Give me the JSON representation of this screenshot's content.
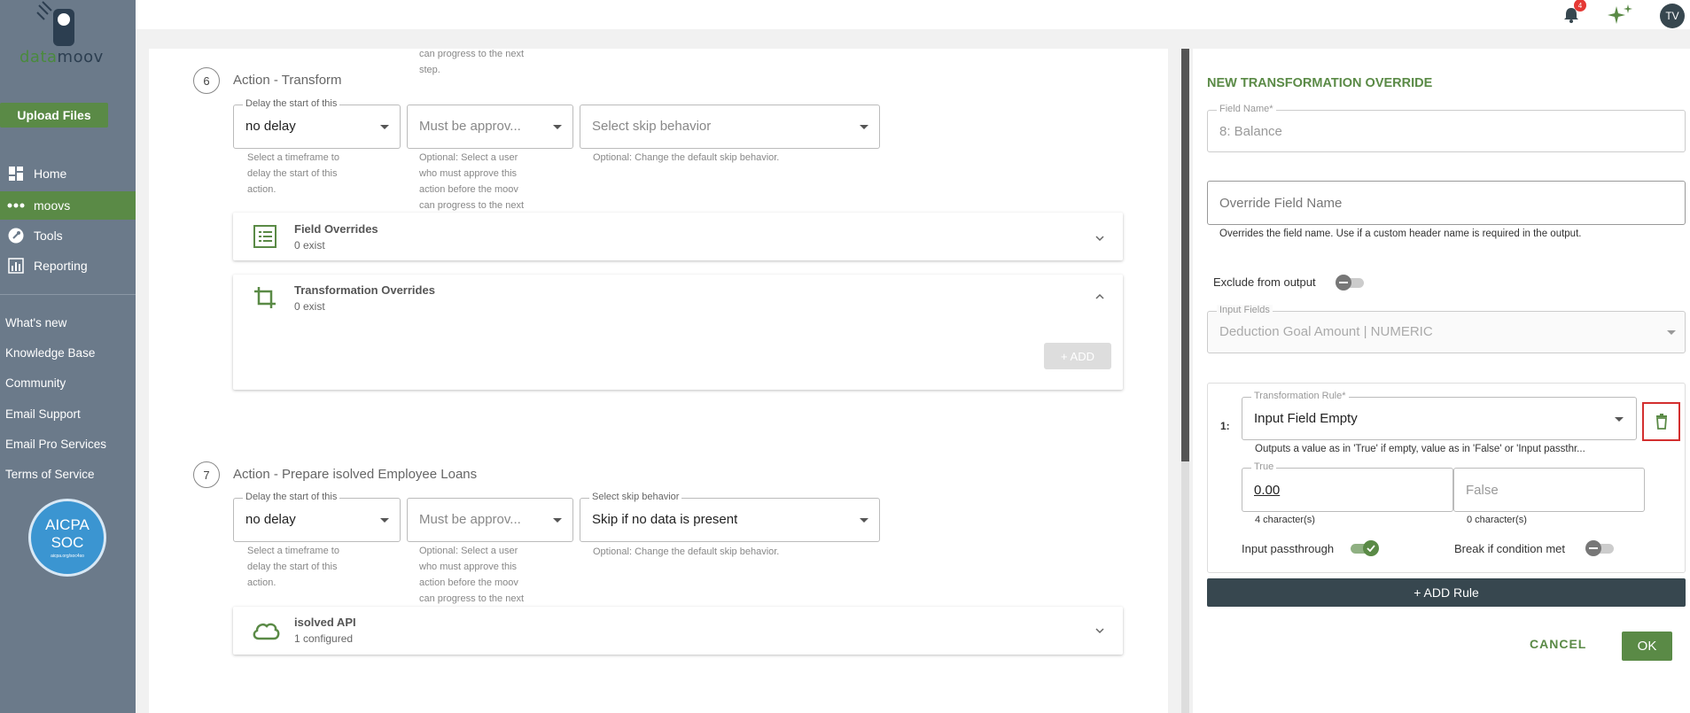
{
  "brand": {
    "logo_part1": "data",
    "logo_part2": "moov",
    "accent": "#5a8a46"
  },
  "sidebar": {
    "upload_label": "Upload Files",
    "nav": [
      {
        "label": "Home",
        "icon": "dashboard-icon"
      },
      {
        "label": "moovs",
        "icon": "dots-icon",
        "active": true
      },
      {
        "label": "Tools",
        "icon": "wrench-icon"
      },
      {
        "label": "Reporting",
        "icon": "bar-chart-icon"
      }
    ],
    "links": [
      "What's new",
      "Knowledge Base",
      "Community",
      "Email Support",
      "Email Pro Services",
      "Terms of Service"
    ],
    "badge": {
      "line1": "AICPA",
      "line2": "SOC",
      "line3": "aicpa.org/soc4so"
    }
  },
  "topbar": {
    "notification_count": "4",
    "avatar_initials": "TV"
  },
  "main": {
    "top_cut_text": [
      "can progress to the next",
      "step."
    ],
    "steps": [
      {
        "number": "6",
        "title": "Action - Transform",
        "delay": {
          "legend": "Delay the start of this",
          "value": "no delay",
          "helper": [
            "Select a timeframe to",
            "delay the start of this",
            "action."
          ]
        },
        "approve": {
          "placeholder": "Must be approv...",
          "helper": [
            "Optional: Select a user",
            "who must approve this",
            "action before the moov",
            "can progress to the next"
          ]
        },
        "skip": {
          "legend": "",
          "placeholder": "Select skip behavior",
          "value": "",
          "helper": "Optional: Change the default skip behavior."
        },
        "cards": [
          {
            "title": "Field Overrides",
            "subtitle": "0 exist",
            "icon": "list-icon",
            "expanded": false
          },
          {
            "title": "Transformation Overrides",
            "subtitle": "0 exist",
            "icon": "crop-icon",
            "expanded": true,
            "add_label": "+ ADD"
          }
        ]
      },
      {
        "number": "7",
        "title": "Action - Prepare isolved Employee Loans",
        "delay": {
          "legend": "Delay the start of this",
          "value": "no delay",
          "helper": [
            "Select a timeframe to",
            "delay the start of this",
            "action."
          ]
        },
        "approve": {
          "placeholder": "Must be approv...",
          "helper": [
            "Optional: Select a user",
            "who must approve this",
            "action before the moov",
            "can progress to the next"
          ]
        },
        "skip": {
          "legend": "Select skip behavior",
          "placeholder": "",
          "value": "Skip if no data is present",
          "helper": "Optional: Change the default skip behavior."
        },
        "cards": [
          {
            "title": "isolved API",
            "subtitle": "1 configured",
            "icon": "cloud-icon",
            "expanded": false
          }
        ]
      }
    ]
  },
  "panel": {
    "title": "NEW TRANSFORMATION OVERRIDE",
    "field_name": {
      "legend": "Field Name*",
      "value": "8: Balance"
    },
    "override": {
      "placeholder": "Override Field Name",
      "helper": "Overrides the field name. Use if a custom header name is required in the output."
    },
    "exclude_label": "Exclude from output",
    "input_fields": {
      "legend": "Input Fields",
      "value": "Deduction Goal Amount | NUMERIC"
    },
    "rule": {
      "index": "1:",
      "legend": "Transformation Rule*",
      "value": "Input Field Empty",
      "helper": "Outputs a value as in 'True' if empty, value as in 'False' or 'Input passthr...",
      "true_legend": "True",
      "true_value": "0.00",
      "true_count": "4 character(s)",
      "false_placeholder": "False",
      "false_count": "0 character(s)",
      "passthrough_label": "Input passthrough",
      "break_label": "Break if condition met"
    },
    "add_rule_label": "+ ADD Rule",
    "cancel_label": "CANCEL",
    "ok_label": "OK"
  }
}
